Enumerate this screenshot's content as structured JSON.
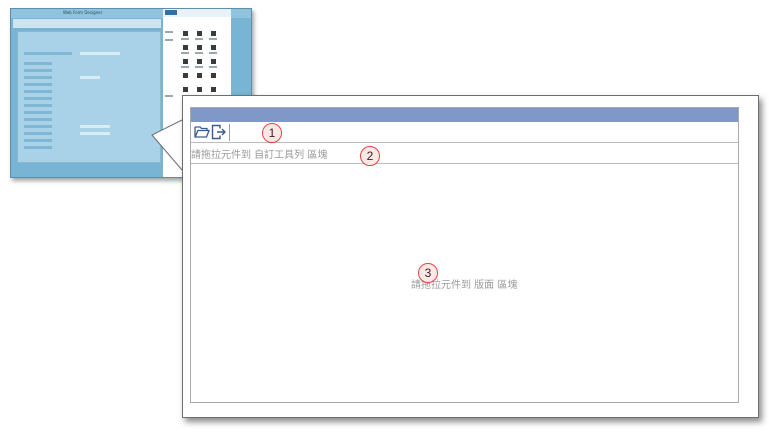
{
  "thumbnail": {
    "title": "Web Form Designer"
  },
  "toolbar": {
    "open_button": {
      "icon": "folder-open-icon"
    },
    "exit_button": {
      "icon": "exit-icon"
    }
  },
  "custom_toolbar": {
    "hint": "請拖拉元件到 自訂工具列 區塊"
  },
  "form_area": {
    "hint": "請拖拉元件到 版面 區塊"
  },
  "markers": [
    "1",
    "2",
    "3"
  ],
  "colors": {
    "header_bar": "#8098c7",
    "marker_border": "#e2453f",
    "thumbnail_bg": "#78b4d4"
  }
}
